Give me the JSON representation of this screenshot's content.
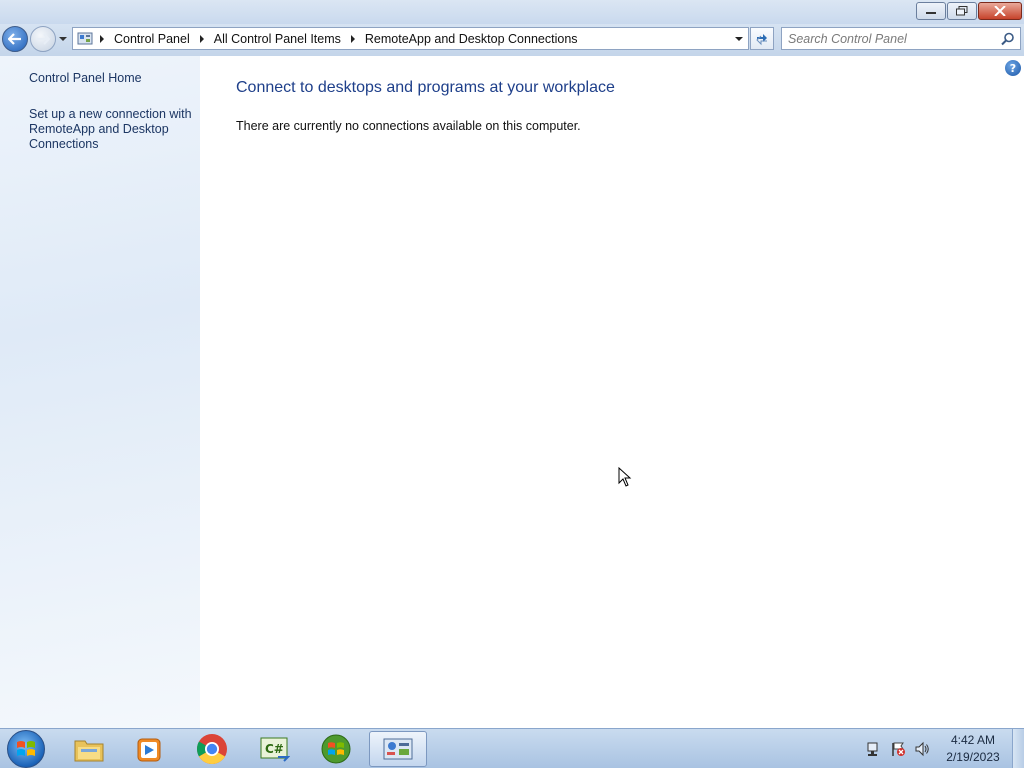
{
  "window": {
    "controls": [
      "minimize",
      "restore",
      "close"
    ]
  },
  "navbar": {
    "breadcrumbs": [
      "Control Panel",
      "All Control Panel Items",
      "RemoteApp and Desktop Connections"
    ],
    "search_placeholder": "Search Control Panel"
  },
  "sidebar": {
    "items": [
      {
        "label": "Control Panel Home"
      },
      {
        "label": "Set up a new connection with RemoteApp and Desktop Connections"
      }
    ]
  },
  "main": {
    "title": "Connect to desktops and programs at your workplace",
    "message": "There are currently no connections available on this computer.",
    "help_label": "?"
  },
  "taskbar": {
    "apps": [
      {
        "name": "Windows Explorer",
        "icon": "folder-icon"
      },
      {
        "name": "Windows Media Player",
        "icon": "media-player-icon"
      },
      {
        "name": "Google Chrome",
        "icon": "chrome-icon"
      },
      {
        "name": "Visual C#",
        "icon": "csharp-icon"
      },
      {
        "name": "Windows Update",
        "icon": "windows-logo-icon"
      },
      {
        "name": "Control Panel",
        "icon": "control-panel-icon",
        "active": true
      }
    ],
    "tray_icons": [
      "network-icon",
      "action-center-flag-icon",
      "volume-icon"
    ],
    "clock": {
      "time": "4:42 AM",
      "date": "2/19/2023"
    }
  },
  "colors": {
    "title_blue": "#1e3f8a",
    "link_blue": "#1c3663",
    "close_red": "#c7432b",
    "taskbar": "#a9c3e2"
  }
}
